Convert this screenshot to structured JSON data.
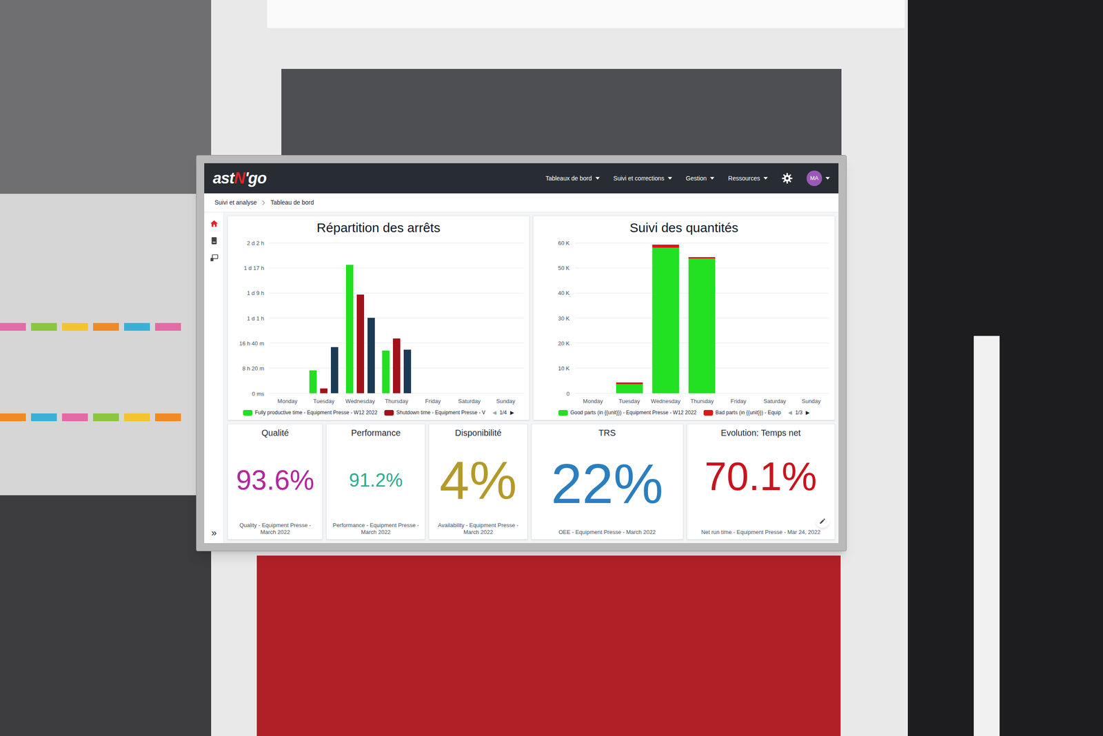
{
  "header": {
    "logo": [
      {
        "text": "ast",
        "color": "#ffffff"
      },
      {
        "text": "N",
        "color": "#e0242b"
      },
      {
        "text": "'go",
        "color": "#ffffff"
      }
    ],
    "nav": [
      {
        "label": "Tableaux de bord"
      },
      {
        "label": "Suivi et corrections"
      },
      {
        "label": "Gestion"
      },
      {
        "label": "Ressources"
      }
    ],
    "avatar": "MA"
  },
  "breadcrumb": [
    "Suivi et analyse",
    "Tableau de bord"
  ],
  "sidebar": {
    "items": [
      {
        "selected": true
      },
      {
        "selected": false
      },
      {
        "selected": false
      }
    ],
    "expand": "»"
  },
  "charts": [
    {
      "title": "Répartition des arrêts",
      "stacked": false,
      "y_ticks": [
        {
          "label": "2 d 2 h",
          "value": 180000
        },
        {
          "label": "1 d 17 h",
          "value": 150000
        },
        {
          "label": "1 d 9 h",
          "value": 120000
        },
        {
          "label": "1 d 1 h",
          "value": 90000
        },
        {
          "label": "16 h 40 m",
          "value": 60000
        },
        {
          "label": "8 h 20 m",
          "value": 30000
        },
        {
          "label": "0 ms",
          "value": 0
        }
      ],
      "x_labels": [
        "Monday",
        "Tuesday",
        "Wednesday",
        "Thursday",
        "Friday",
        "Saturday",
        "Sunday"
      ],
      "series": [
        {
          "legend": "Fully productive time - Equipment Presse - W12 2022",
          "color": "#22e022",
          "values": [
            0,
            27000,
            153600,
            51000,
            0,
            0,
            0
          ]
        },
        {
          "legend": "Shutdown time - Equipment Presse - V",
          "color": "#a3111b",
          "values": [
            0,
            5500,
            118000,
            65500,
            0,
            0,
            0
          ]
        },
        {
          "color": "#1d3a54",
          "values": [
            0,
            55000,
            90000,
            52000,
            0,
            0,
            0
          ]
        }
      ],
      "pager": {
        "prev": "◀",
        "text": "1/4",
        "next": "▶",
        "prev_disabled": true
      }
    },
    {
      "title": "Suivi des quantités",
      "stacked": true,
      "y_ticks": [
        {
          "label": "60 K",
          "value": 60000
        },
        {
          "label": "50 K",
          "value": 50000
        },
        {
          "label": "40 K",
          "value": 40000
        },
        {
          "label": "30 K",
          "value": 30000
        },
        {
          "label": "20 K",
          "value": 20000
        },
        {
          "label": "10 K",
          "value": 10000
        },
        {
          "label": "0",
          "value": 0
        }
      ],
      "x_labels": [
        "Monday",
        "Tuesday",
        "Wednesday",
        "Thursday",
        "Friday",
        "Saturday",
        "Sunday"
      ],
      "series": [
        {
          "legend": "Good parts (in {{unit}}) - Equipment Presse - W12 2022",
          "color": "#22e022",
          "values": [
            0,
            3500,
            58000,
            53800,
            0,
            0,
            0
          ]
        },
        {
          "legend": "Bad parts (in {{unit}}) - Equip",
          "color": "#e01515",
          "values": [
            0,
            800,
            1200,
            400,
            0,
            0,
            0
          ]
        }
      ],
      "pager": {
        "prev": "◀",
        "text": "1/3",
        "next": "▶",
        "prev_disabled": true
      }
    }
  ],
  "kpis": [
    {
      "title": "Qualité",
      "value": "93.6%",
      "caption": "Quality - Equipment Presse - March 2022",
      "color": "#b3279f"
    },
    {
      "title": "Performance",
      "value": "91.2%",
      "caption": "Performance - Equipment Presse - March 2022",
      "color": "#2bae8e"
    },
    {
      "title": "Disponibilité",
      "value": "4%",
      "caption": "Availability - Equipment Presse - March 2022",
      "color": "#b39a2a"
    },
    {
      "title": "TRS",
      "value": "22%",
      "caption": "OEE - Equipment Presse - March 2022",
      "color": "#2a7fc0"
    },
    {
      "title": "Evolution: Temps net",
      "value": "70.1%",
      "caption": "Net run time - Equipment Presse - Mar 24, 2022",
      "color": "#c8141e"
    }
  ]
}
